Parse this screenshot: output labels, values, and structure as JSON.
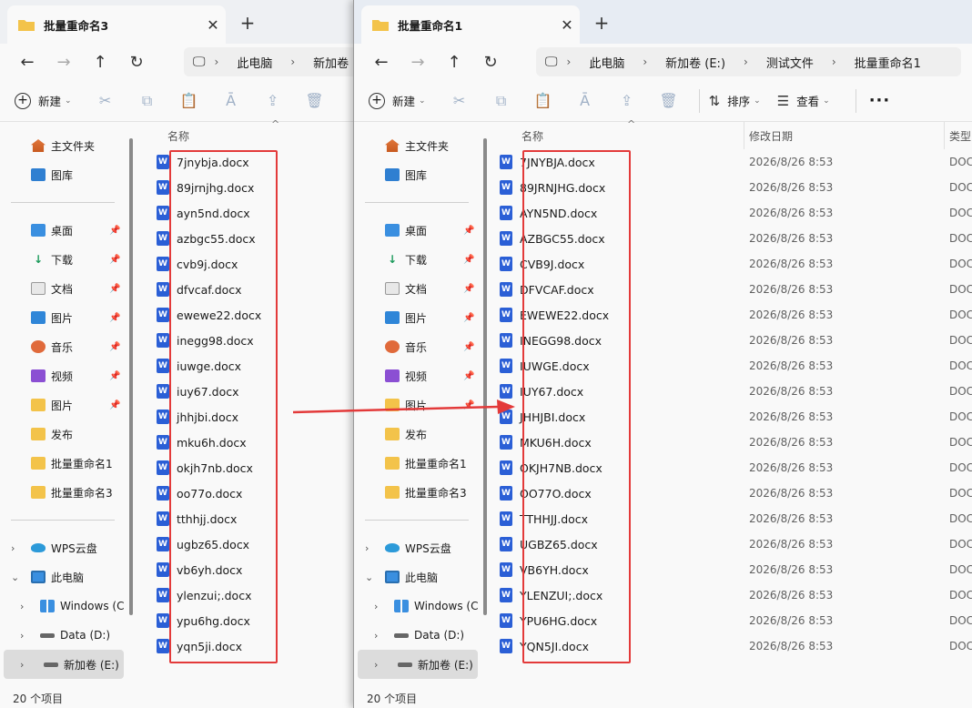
{
  "left": {
    "tab_title": "批量重命名3",
    "breadcrumbs": [
      "此电脑",
      "新加卷"
    ],
    "toolbar": {
      "new_label": "新建"
    },
    "sidebar": {
      "quick": [
        "主文件夹",
        "图库"
      ],
      "pinned": [
        "桌面",
        "下载",
        "文档",
        "图片",
        "音乐",
        "视频",
        "图片",
        "发布",
        "批量重命名1",
        "批量重命名3"
      ],
      "tree": [
        "WPS云盘",
        "此电脑",
        "Windows (C",
        "Data (D:)",
        "新加卷 (E:)"
      ]
    },
    "column_name": "名称",
    "files": [
      "7jnybja.docx",
      "89jrnjhg.docx",
      "ayn5nd.docx",
      "azbgc55.docx",
      "cvb9j.docx",
      "dfvcaf.docx",
      "ewewe22.docx",
      "inegg98.docx",
      "iuwge.docx",
      "iuy67.docx",
      "jhhjbi.docx",
      "mku6h.docx",
      "okjh7nb.docx",
      "oo77o.docx",
      "tthhjj.docx",
      "ugbz65.docx",
      "vb6yh.docx",
      "ylenzui;.docx",
      "ypu6hg.docx",
      "yqn5ji.docx"
    ],
    "status": "20 个项目"
  },
  "right": {
    "tab_title": "批量重命名1",
    "breadcrumbs": [
      "此电脑",
      "新加卷 (E:)",
      "测试文件",
      "批量重命名1"
    ],
    "toolbar": {
      "new_label": "新建",
      "sort_label": "排序",
      "view_label": "查看",
      "more_label": "···"
    },
    "sidebar": {
      "quick": [
        "主文件夹",
        "图库"
      ],
      "pinned": [
        "桌面",
        "下载",
        "文档",
        "图片",
        "音乐",
        "视频",
        "图片",
        "发布",
        "批量重命名1",
        "批量重命名3"
      ],
      "tree": [
        "WPS云盘",
        "此电脑",
        "Windows (C",
        "Data (D:)",
        "新加卷 (E:)"
      ]
    },
    "columns": {
      "name": "名称",
      "date": "修改日期",
      "type": "类型"
    },
    "file_date": "2026/8/26 8:53",
    "file_type": "DOC",
    "files": [
      "7JNYBJA.docx",
      "89JRNJHG.docx",
      "AYN5ND.docx",
      "AZBGC55.docx",
      "CVB9J.docx",
      "DFVCAF.docx",
      "EWEWE22.docx",
      "INEGG98.docx",
      "IUWGE.docx",
      "IUY67.docx",
      "JHHJBI.docx",
      "MKU6H.docx",
      "OKJH7NB.docx",
      "OO77O.docx",
      "TTHHJJ.docx",
      "UGBZ65.docx",
      "VB6YH.docx",
      "YLENZUI;.docx",
      "YPU6HG.docx",
      "YQN5JI.docx"
    ],
    "status": "20 个项目"
  },
  "colors": {
    "highlight_box": "#e33a3a",
    "arrow": "#e33a3a",
    "word_icon": "#2b5fd6",
    "folder": "#f3c34a"
  },
  "icons": [
    "folder-icon",
    "close-icon",
    "plus-icon",
    "back-icon",
    "forward-icon",
    "up-icon",
    "refresh-icon",
    "pc-icon",
    "cut-icon",
    "copy-icon",
    "paste-icon",
    "rename-icon",
    "share-icon",
    "delete-icon",
    "sort-icon",
    "view-icon",
    "word-doc-icon",
    "pin-icon",
    "chevron-icon"
  ]
}
